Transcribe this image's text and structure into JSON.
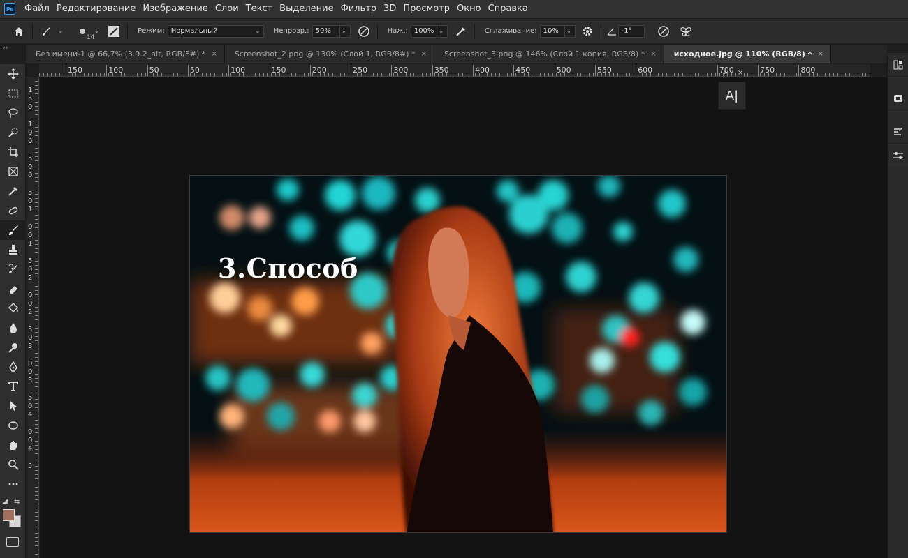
{
  "menu": {
    "logo": "Ps",
    "items": [
      "Файл",
      "Редактирование",
      "Изображение",
      "Слои",
      "Текст",
      "Выделение",
      "Фильтр",
      "3D",
      "Просмотр",
      "Окно",
      "Справка"
    ]
  },
  "options": {
    "brush_size": "14",
    "mode_label": "Режим:",
    "mode_value": "Нормальный",
    "opacity_label": "Непрозр.:",
    "opacity_value": "50%",
    "pressure_label": "Наж.:",
    "pressure_value": "100%",
    "smoothing_label": "Сглаживание:",
    "smoothing_value": "10%",
    "angle_value": "-1°"
  },
  "tabs": [
    {
      "label": "Без имени-1 @ 66,7% (3.9.2_alt, RGB/8#) *",
      "close": "×"
    },
    {
      "label": "Screenshot_2.png @ 130% (Слой 1, RGB/8#) *",
      "close": "×"
    },
    {
      "label": "Screenshot_3.png @ 146% (Слой 1 копия, RGB/8) *",
      "close": "×"
    },
    {
      "label": "исходное.jpg @ 110% (RGB/8) *",
      "close": "×"
    }
  ],
  "ruler_top": [
    "150",
    "100",
    "50",
    "50",
    "100",
    "150",
    "200",
    "250",
    "300",
    "350",
    "400",
    "450",
    "500",
    "550",
    "600",
    "700",
    "750",
    "800"
  ],
  "ruler_left": [
    "1",
    "5",
    "0",
    "1",
    "0",
    "0",
    "5",
    "0",
    "0",
    "5",
    "0",
    "1",
    "0",
    "0",
    "1",
    "5",
    "0",
    "2",
    "0",
    "0",
    "2",
    "5",
    "0",
    "3",
    "0",
    "0",
    "3",
    "5",
    "0",
    "4",
    "0",
    "0",
    "4",
    "5"
  ],
  "canvas": {
    "title_text": "3.Способ"
  },
  "panels": {
    "collapse": "»",
    "close": "×",
    "character_button": "A|"
  },
  "colors": {
    "foreground": "#a0705e",
    "background": "#d8d8d8",
    "accent": "#31a8ff"
  }
}
